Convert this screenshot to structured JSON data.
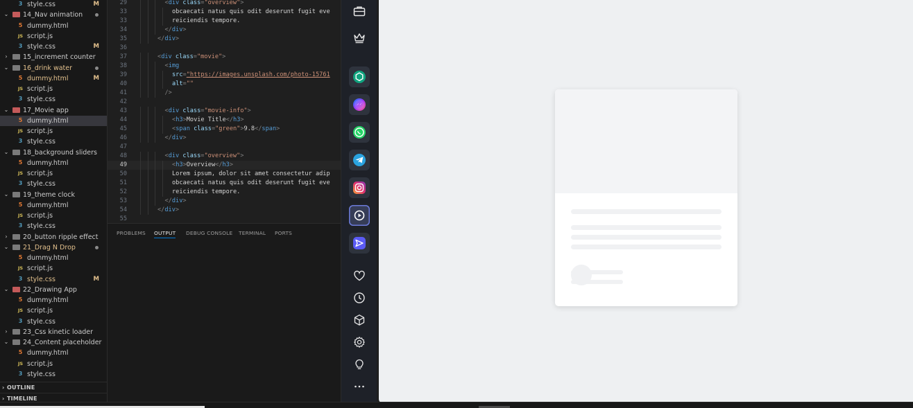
{
  "explorer": {
    "items": [
      {
        "name": "style.css",
        "kind": "css",
        "depth": 1,
        "badge": "M"
      },
      {
        "name": "14_Nav animation",
        "kind": "folder-red",
        "depth": 0,
        "open": true,
        "dot": true
      },
      {
        "name": "dummy.html",
        "kind": "html",
        "depth": 1
      },
      {
        "name": "script.js",
        "kind": "js",
        "depth": 1
      },
      {
        "name": "style.css",
        "kind": "css",
        "depth": 1,
        "badge": "M"
      },
      {
        "name": "15_increment counter",
        "kind": "folder",
        "depth": 0,
        "open": false
      },
      {
        "name": "16_drink water",
        "kind": "folder",
        "depth": 0,
        "open": true,
        "dot": true,
        "color": "#e2c08d"
      },
      {
        "name": "dummy.html",
        "kind": "html",
        "depth": 1,
        "badge": "M",
        "color": "#e2c08d"
      },
      {
        "name": "script.js",
        "kind": "js",
        "depth": 1
      },
      {
        "name": "style.css",
        "kind": "css",
        "depth": 1
      },
      {
        "name": "17_Movie app",
        "kind": "folder-red",
        "depth": 0,
        "open": true
      },
      {
        "name": "dummy.html",
        "kind": "html",
        "depth": 1,
        "selected": true
      },
      {
        "name": "script.js",
        "kind": "js",
        "depth": 1
      },
      {
        "name": "style.css",
        "kind": "css",
        "depth": 1
      },
      {
        "name": "18_background sliders",
        "kind": "folder",
        "depth": 0,
        "open": true
      },
      {
        "name": "dummy.html",
        "kind": "html",
        "depth": 1
      },
      {
        "name": "script.js",
        "kind": "js",
        "depth": 1
      },
      {
        "name": "style.css",
        "kind": "css",
        "depth": 1
      },
      {
        "name": "19_theme clock",
        "kind": "folder",
        "depth": 0,
        "open": true
      },
      {
        "name": "dummy.html",
        "kind": "html",
        "depth": 1
      },
      {
        "name": "script.js",
        "kind": "js",
        "depth": 1
      },
      {
        "name": "style.css",
        "kind": "css",
        "depth": 1
      },
      {
        "name": "20_button ripple effect",
        "kind": "folder",
        "depth": 0,
        "open": false
      },
      {
        "name": "21_Drag N Drop",
        "kind": "folder",
        "depth": 0,
        "open": true,
        "dot": true,
        "color": "#e2c08d"
      },
      {
        "name": "dummy.html",
        "kind": "html",
        "depth": 1
      },
      {
        "name": "script.js",
        "kind": "js",
        "depth": 1
      },
      {
        "name": "style.css",
        "kind": "css",
        "depth": 1,
        "badge": "M",
        "color": "#e2c08d"
      },
      {
        "name": "22_Drawing App",
        "kind": "folder-red",
        "depth": 0,
        "open": true
      },
      {
        "name": "dummy.html",
        "kind": "html",
        "depth": 1
      },
      {
        "name": "script.js",
        "kind": "js",
        "depth": 1
      },
      {
        "name": "style.css",
        "kind": "css",
        "depth": 1
      },
      {
        "name": "23_Css kinetic loader",
        "kind": "folder",
        "depth": 0,
        "open": false
      },
      {
        "name": "24_Content placeholder",
        "kind": "folder",
        "depth": 0,
        "open": true
      },
      {
        "name": "dummy.html",
        "kind": "html",
        "depth": 1
      },
      {
        "name": "script.js",
        "kind": "js",
        "depth": 1
      },
      {
        "name": "style.css",
        "kind": "css",
        "depth": 1
      }
    ],
    "outline_label": "OUTLINE",
    "timeline_label": "TIMELINE",
    "colors": {
      "modified": "#e2c08d",
      "default": "#cccccc"
    }
  },
  "editor": {
    "current_line": "49",
    "lines": [
      {
        "n": "29",
        "indent": 4,
        "tokens": [
          [
            "t",
            "<"
          ],
          [
            "g",
            "div "
          ],
          [
            "a",
            "class"
          ],
          [
            "t",
            "="
          ],
          [
            "s",
            "\"overview\""
          ],
          [
            "t",
            ">"
          ]
        ]
      },
      {
        "n": "33",
        "indent": 5,
        "tokens": [
          [
            "x",
            "obcaecati natus quis odit deserunt fugit eve"
          ]
        ]
      },
      {
        "n": "33",
        "indent": 5,
        "tokens": [
          [
            "x",
            "reiciendis tempore."
          ]
        ]
      },
      {
        "n": "34",
        "indent": 4,
        "tokens": [
          [
            "t",
            "</"
          ],
          [
            "g",
            "div"
          ],
          [
            "t",
            ">"
          ]
        ]
      },
      {
        "n": "35",
        "indent": 3,
        "tokens": [
          [
            "t",
            "</"
          ],
          [
            "g",
            "div"
          ],
          [
            "t",
            ">"
          ]
        ]
      },
      {
        "n": "36",
        "indent": 0,
        "tokens": []
      },
      {
        "n": "37",
        "indent": 3,
        "tokens": [
          [
            "t",
            "<"
          ],
          [
            "g",
            "div "
          ],
          [
            "a",
            "class"
          ],
          [
            "t",
            "="
          ],
          [
            "s",
            "\"movie\""
          ],
          [
            "t",
            ">"
          ]
        ]
      },
      {
        "n": "38",
        "indent": 4,
        "tokens": [
          [
            "t",
            "<"
          ],
          [
            "g",
            "img"
          ]
        ]
      },
      {
        "n": "39",
        "indent": 5,
        "tokens": [
          [
            "a",
            "src"
          ],
          [
            "t",
            "="
          ],
          [
            "l",
            "\"https://images.unsplash.com/photo-15761"
          ]
        ]
      },
      {
        "n": "40",
        "indent": 5,
        "tokens": [
          [
            "a",
            "alt"
          ],
          [
            "t",
            "="
          ],
          [
            "s",
            "\"\""
          ]
        ]
      },
      {
        "n": "41",
        "indent": 4,
        "tokens": [
          [
            "t",
            "/>"
          ]
        ]
      },
      {
        "n": "42",
        "indent": 0,
        "tokens": []
      },
      {
        "n": "43",
        "indent": 4,
        "tokens": [
          [
            "t",
            "<"
          ],
          [
            "g",
            "div "
          ],
          [
            "a",
            "class"
          ],
          [
            "t",
            "="
          ],
          [
            "s",
            "\"movie-info\""
          ],
          [
            "t",
            ">"
          ]
        ]
      },
      {
        "n": "44",
        "indent": 5,
        "tokens": [
          [
            "t",
            "<"
          ],
          [
            "g",
            "h3"
          ],
          [
            "t",
            ">"
          ],
          [
            "x",
            "Movie Title"
          ],
          [
            "t",
            "</"
          ],
          [
            "g",
            "h3"
          ],
          [
            "t",
            ">"
          ]
        ]
      },
      {
        "n": "45",
        "indent": 5,
        "tokens": [
          [
            "t",
            "<"
          ],
          [
            "g",
            "span "
          ],
          [
            "a",
            "class"
          ],
          [
            "t",
            "="
          ],
          [
            "s",
            "\"green\""
          ],
          [
            "t",
            ">"
          ],
          [
            "x",
            "9.8"
          ],
          [
            "t",
            "</"
          ],
          [
            "g",
            "span"
          ],
          [
            "t",
            ">"
          ]
        ]
      },
      {
        "n": "46",
        "indent": 4,
        "tokens": [
          [
            "t",
            "</"
          ],
          [
            "g",
            "div"
          ],
          [
            "t",
            ">"
          ]
        ]
      },
      {
        "n": "47",
        "indent": 0,
        "tokens": []
      },
      {
        "n": "48",
        "indent": 4,
        "tokens": [
          [
            "t",
            "<"
          ],
          [
            "g",
            "div "
          ],
          [
            "a",
            "class"
          ],
          [
            "t",
            "="
          ],
          [
            "s",
            "\"overview\""
          ],
          [
            "t",
            ">"
          ]
        ]
      },
      {
        "n": "49",
        "indent": 5,
        "tokens": [
          [
            "t",
            "<"
          ],
          [
            "g",
            "h3"
          ],
          [
            "t",
            ">"
          ],
          [
            "x",
            "Overview"
          ],
          [
            "t",
            "</"
          ],
          [
            "g",
            "h3"
          ],
          [
            "t",
            ">"
          ]
        ]
      },
      {
        "n": "50",
        "indent": 5,
        "tokens": [
          [
            "x",
            "Lorem ipsum, dolor sit amet consectetur adip"
          ]
        ]
      },
      {
        "n": "51",
        "indent": 5,
        "tokens": [
          [
            "x",
            "obcaecati natus quis odit deserunt fugit eve"
          ]
        ]
      },
      {
        "n": "52",
        "indent": 5,
        "tokens": [
          [
            "x",
            "reiciendis tempore."
          ]
        ]
      },
      {
        "n": "53",
        "indent": 4,
        "tokens": [
          [
            "t",
            "</"
          ],
          [
            "g",
            "div"
          ],
          [
            "t",
            ">"
          ]
        ]
      },
      {
        "n": "54",
        "indent": 3,
        "tokens": [
          [
            "t",
            "</"
          ],
          [
            "g",
            "div"
          ],
          [
            "t",
            ">"
          ]
        ]
      },
      {
        "n": "55",
        "indent": 0,
        "tokens": []
      }
    ]
  },
  "panel": {
    "tabs": [
      {
        "label": "PROBLEMS",
        "active": false
      },
      {
        "label": "OUTPUT",
        "active": true
      },
      {
        "label": "DEBUG CONSOLE",
        "active": false
      },
      {
        "label": "TERMINAL",
        "active": false
      },
      {
        "label": "PORTS",
        "active": false
      }
    ],
    "accent": "#0078d4"
  },
  "dock": {
    "top_icons": [
      "briefcase-icon",
      "crown-icon"
    ],
    "apps": [
      {
        "icon": "chatgpt-icon",
        "color": "#10a37f"
      },
      {
        "icon": "messenger-icon",
        "color": "#7b5cf5"
      },
      {
        "icon": "whatsapp-icon",
        "color": "#25d366"
      },
      {
        "icon": "telegram-icon",
        "color": "#2aa3e0"
      },
      {
        "icon": "instagram-icon",
        "color": "#e1306c"
      },
      {
        "icon": "play-icon",
        "color": "#ffffff",
        "active": true
      },
      {
        "icon": "send-icon",
        "color": "#5b5bf5"
      }
    ],
    "bottom_icons": [
      "heart-icon",
      "clock-icon",
      "cube-icon",
      "gear-icon",
      "lightbulb-icon",
      "more-icon"
    ]
  },
  "preview": {
    "background": "#eef0f2",
    "card_placeholder": {
      "hero_color": "#f3f4f6",
      "line_color": "#f0f1f3"
    }
  }
}
